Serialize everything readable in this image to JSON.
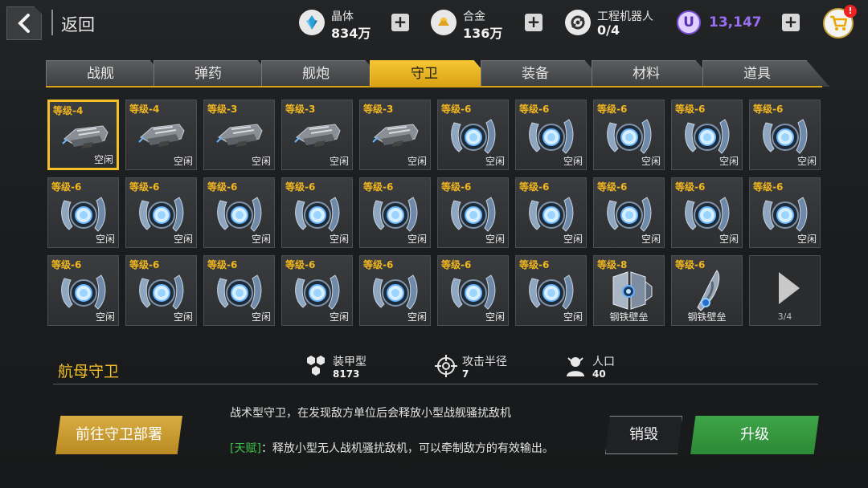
{
  "header": {
    "back_label": "返回",
    "resources": [
      {
        "name": "晶体",
        "value": "834万",
        "icon": "crystal-icon"
      },
      {
        "name": "合金",
        "value": "136万",
        "icon": "alloy-icon"
      },
      {
        "name": "工程机器人",
        "value": "0/4",
        "icon": "robot-icon"
      }
    ],
    "premium": {
      "symbol": "U",
      "value": "13,147"
    },
    "cart_badge": "!"
  },
  "tabs": [
    {
      "label": "战舰",
      "active": false
    },
    {
      "label": "弹药",
      "active": false
    },
    {
      "label": "舰炮",
      "active": false
    },
    {
      "label": "守卫",
      "active": true
    },
    {
      "label": "装备",
      "active": false
    },
    {
      "label": "材料",
      "active": false
    },
    {
      "label": "道具",
      "active": false
    }
  ],
  "items": [
    {
      "level": "等级-4",
      "status": "空闲",
      "kind": "carrier",
      "selected": true
    },
    {
      "level": "等级-4",
      "status": "空闲",
      "kind": "carrier"
    },
    {
      "level": "等级-3",
      "status": "空闲",
      "kind": "carrier"
    },
    {
      "level": "等级-3",
      "status": "空闲",
      "kind": "carrier"
    },
    {
      "level": "等级-3",
      "status": "空闲",
      "kind": "carrier"
    },
    {
      "level": "等级-6",
      "status": "空闲",
      "kind": "shield"
    },
    {
      "level": "等级-6",
      "status": "空闲",
      "kind": "shield"
    },
    {
      "level": "等级-6",
      "status": "空闲",
      "kind": "shield"
    },
    {
      "level": "等级-6",
      "status": "空闲",
      "kind": "shield"
    },
    {
      "level": "等级-6",
      "status": "空闲",
      "kind": "shield"
    },
    {
      "level": "等级-6",
      "status": "空闲",
      "kind": "shield"
    },
    {
      "level": "等级-6",
      "status": "空闲",
      "kind": "shield"
    },
    {
      "level": "等级-6",
      "status": "空闲",
      "kind": "shield"
    },
    {
      "level": "等级-6",
      "status": "空闲",
      "kind": "shield"
    },
    {
      "level": "等级-6",
      "status": "空闲",
      "kind": "shield"
    },
    {
      "level": "等级-6",
      "status": "空闲",
      "kind": "shield"
    },
    {
      "level": "等级-6",
      "status": "空闲",
      "kind": "shield"
    },
    {
      "level": "等级-6",
      "status": "空闲",
      "kind": "shield"
    },
    {
      "level": "等级-6",
      "status": "空闲",
      "kind": "shield"
    },
    {
      "level": "等级-6",
      "status": "空闲",
      "kind": "shield"
    },
    {
      "level": "等级-6",
      "status": "空闲",
      "kind": "shield"
    },
    {
      "level": "等级-6",
      "status": "空闲",
      "kind": "shield"
    },
    {
      "level": "等级-6",
      "status": "空闲",
      "kind": "shield"
    },
    {
      "level": "等级-6",
      "status": "空闲",
      "kind": "shield"
    },
    {
      "level": "等级-6",
      "status": "空闲",
      "kind": "shield"
    },
    {
      "level": "等级-6",
      "status": "空闲",
      "kind": "shield"
    },
    {
      "level": "等级-6",
      "status": "空闲",
      "kind": "shield"
    },
    {
      "level": "等级-8",
      "name": "钢铁壁垒",
      "kind": "fortress"
    },
    {
      "level": "等级-6",
      "name": "钢铁壁垒",
      "kind": "blade"
    }
  ],
  "pager": {
    "text": "3/4"
  },
  "detail": {
    "title": "航母守卫",
    "stats": [
      {
        "name": "装甲型",
        "value": "8173",
        "icon": "armor-hex-icon"
      },
      {
        "name": "攻击半径",
        "value": "7",
        "icon": "crosshair-icon"
      },
      {
        "name": "人口",
        "value": "40",
        "icon": "population-icon"
      }
    ],
    "description": "战术型守卫，在发现敌方单位后会释放小型战舰骚扰敌机",
    "talent_tag": "[天赋]",
    "talent_text": "：释放小型无人战机骚扰敌机，可以牵制敌方的有效输出。"
  },
  "buttons": {
    "deploy": "前往守卫部署",
    "destroy": "销毁",
    "upgrade": "升级"
  },
  "colors": {
    "accent": "#f2c12a",
    "upgrade": "#3ea448",
    "premium": "#9a6ef0",
    "talent": "#3fc14a"
  }
}
